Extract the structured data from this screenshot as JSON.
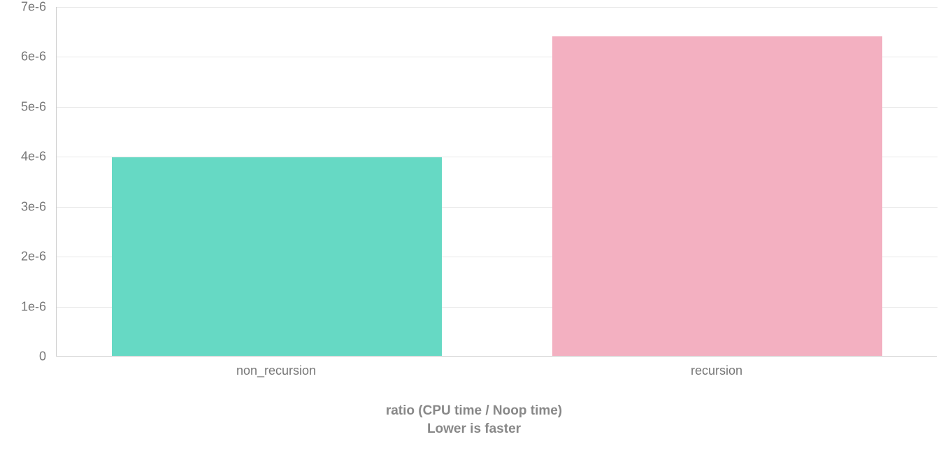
{
  "chart_data": {
    "type": "bar",
    "categories": [
      "non_recursion",
      "recursion"
    ],
    "values": [
      3.98e-06,
      6.4e-06
    ],
    "title": "",
    "xlabel": "",
    "ylabel": "",
    "ylim": [
      0,
      7e-06
    ],
    "caption_line1": "ratio (CPU time / Noop time)",
    "caption_line2": "Lower is faster",
    "y_ticks": [
      "0",
      "1e-6",
      "2e-6",
      "3e-6",
      "4e-6",
      "5e-6",
      "6e-6",
      "7e-6"
    ],
    "colors": [
      "#66d9c4",
      "#f3b0c1"
    ]
  }
}
